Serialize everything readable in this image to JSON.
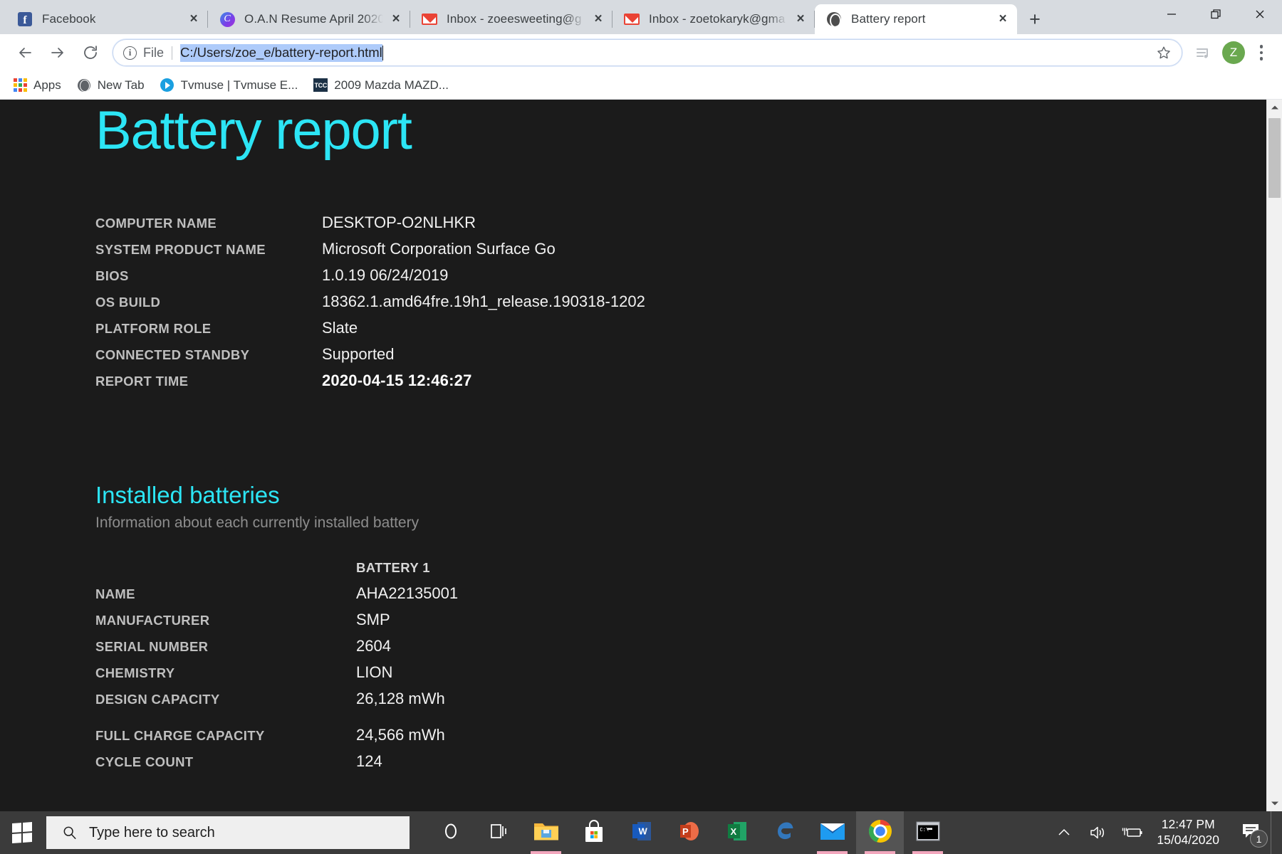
{
  "browser": {
    "tabs": [
      {
        "title": "Facebook",
        "favicon": "facebook-icon",
        "active": false
      },
      {
        "title": "O.A.N Resume April 2020",
        "favicon": "canva-icon",
        "active": false
      },
      {
        "title": "Inbox - zoeesweeting@g",
        "favicon": "gmail-icon",
        "active": false
      },
      {
        "title": "Inbox - zoetokaryk@gma",
        "favicon": "gmail-icon",
        "active": false
      },
      {
        "title": "Battery report",
        "favicon": "globe-icon",
        "active": true
      }
    ],
    "tab_close_label": "×",
    "new_tab_label": "+",
    "window_controls": {
      "minimize": "—",
      "maximize": "❐",
      "close": "×"
    },
    "omnibox": {
      "scheme_label": "File",
      "url": "C:/Users/zoe_e/battery-report.html",
      "url_selected": true
    },
    "profile_initial": "Z",
    "bookmarks": [
      {
        "label": "Apps",
        "icon": "apps-grid-icon"
      },
      {
        "label": "New Tab",
        "icon": "globe-icon"
      },
      {
        "label": "Tvmuse | Tvmuse E...",
        "icon": "tvmuse-icon"
      },
      {
        "label": "2009 Mazda MAZD...",
        "icon": "tcc-icon"
      }
    ]
  },
  "page": {
    "title": "Battery report",
    "system_info": [
      {
        "key": "COMPUTER NAME",
        "value": "DESKTOP-O2NLHKR",
        "bold": false
      },
      {
        "key": "SYSTEM PRODUCT NAME",
        "value": "Microsoft Corporation Surface Go",
        "bold": false
      },
      {
        "key": "BIOS",
        "value": "1.0.19 06/24/2019",
        "bold": false
      },
      {
        "key": "OS BUILD",
        "value": "18362.1.amd64fre.19h1_release.190318-1202",
        "bold": false
      },
      {
        "key": "PLATFORM ROLE",
        "value": "Slate",
        "bold": false
      },
      {
        "key": "CONNECTED STANDBY",
        "value": "Supported",
        "bold": false
      },
      {
        "key": "REPORT TIME",
        "value": "2020-04-15  12:46:27",
        "bold": true
      }
    ],
    "installed_batteries": {
      "heading": "Installed batteries",
      "subheading": "Information about each currently installed battery",
      "column_header": "BATTERY 1",
      "rows": [
        {
          "key": "NAME",
          "value": "AHA22135001",
          "gap": false
        },
        {
          "key": "MANUFACTURER",
          "value": "SMP",
          "gap": false
        },
        {
          "key": "SERIAL NUMBER",
          "value": "2604",
          "gap": false
        },
        {
          "key": "CHEMISTRY",
          "value": "LION",
          "gap": false
        },
        {
          "key": "DESIGN CAPACITY",
          "value": "26,128 mWh",
          "gap": false
        },
        {
          "key": "FULL CHARGE CAPACITY",
          "value": "24,566 mWh",
          "gap": true
        },
        {
          "key": "CYCLE COUNT",
          "value": "124",
          "gap": false
        }
      ]
    },
    "colors": {
      "background": "#1b1b1b",
      "accent": "#2ce5f5",
      "key_text": "#bfbfbf",
      "value_text": "#f1f1f1"
    }
  },
  "taskbar": {
    "start_label": "windows-logo",
    "search_placeholder": "Type here to search",
    "apps": [
      {
        "name": "cortana-icon",
        "running": false
      },
      {
        "name": "task-view-icon",
        "running": false
      },
      {
        "name": "file-explorer-icon",
        "running": true
      },
      {
        "name": "microsoft-store-icon",
        "running": false
      },
      {
        "name": "word-icon",
        "running": false,
        "letter": "W"
      },
      {
        "name": "powerpoint-icon",
        "running": false,
        "letter": "P"
      },
      {
        "name": "excel-icon",
        "running": false,
        "letter": "X"
      },
      {
        "name": "edge-icon",
        "running": false
      },
      {
        "name": "mail-icon",
        "running": true
      },
      {
        "name": "chrome-icon",
        "running": true,
        "active": true
      },
      {
        "name": "command-prompt-icon",
        "running": true
      }
    ],
    "tray": {
      "show_hidden": "chevron-up-icon",
      "volume": "speaker-icon",
      "power": "battery-charging-icon",
      "time": "12:47 PM",
      "date": "15/04/2020",
      "notification_count": "1"
    }
  }
}
